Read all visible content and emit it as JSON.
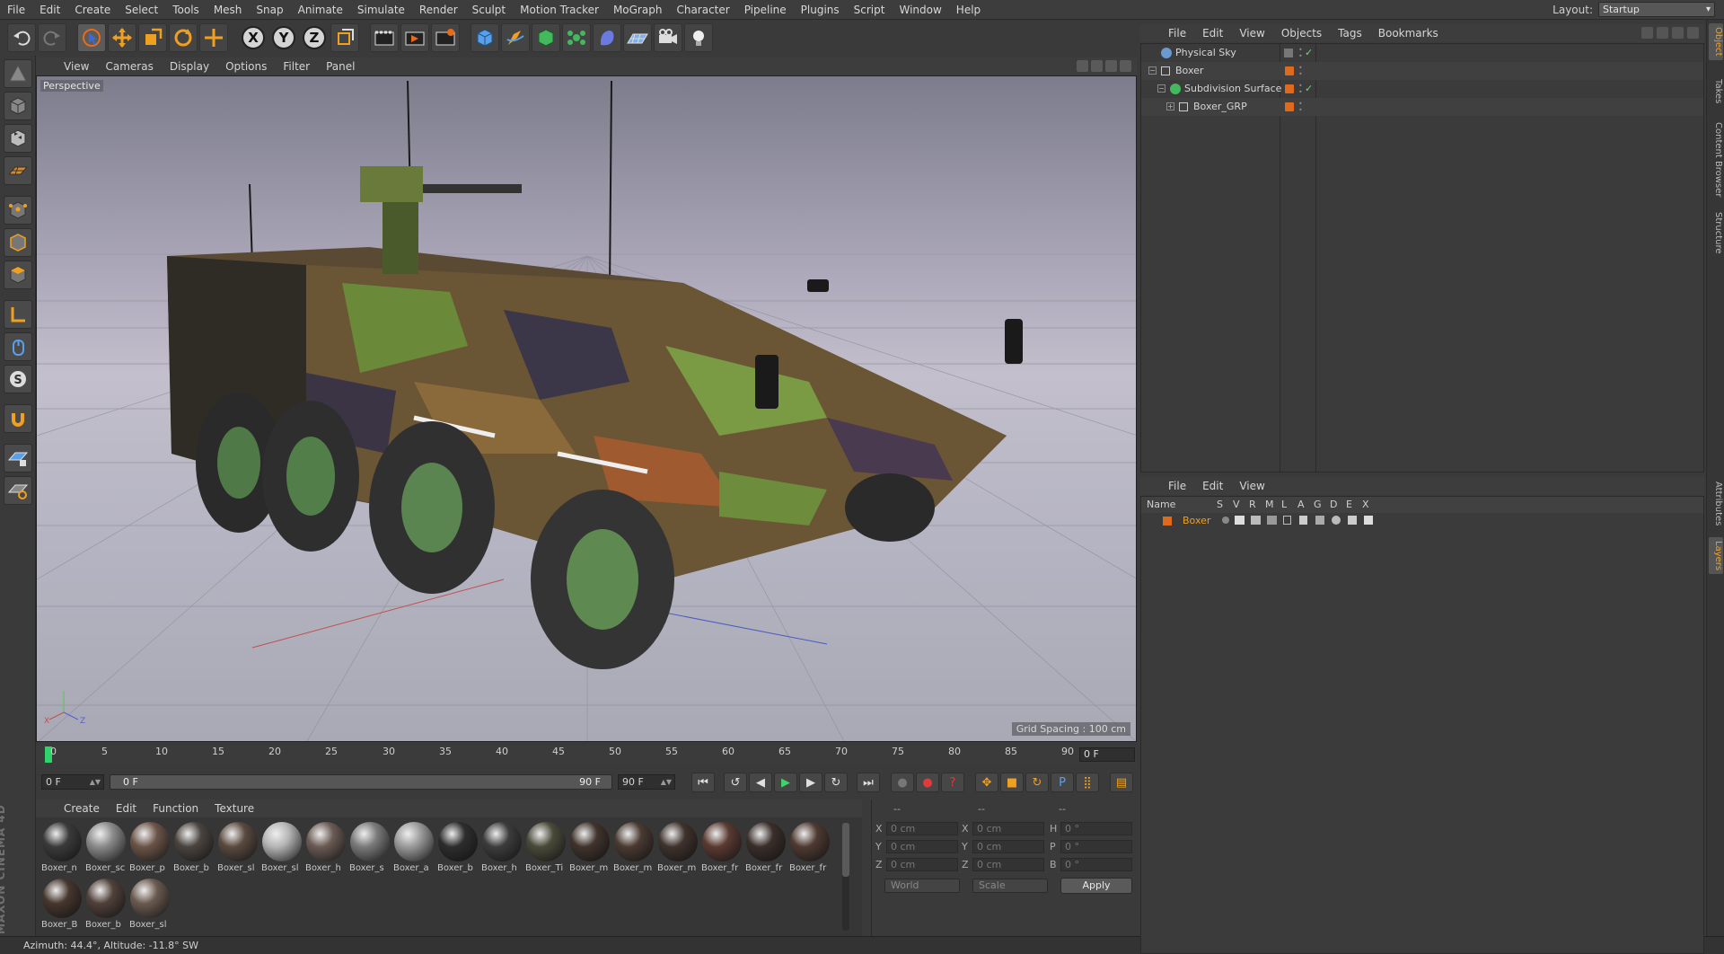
{
  "menubar": {
    "items": [
      "File",
      "Edit",
      "Create",
      "Select",
      "Tools",
      "Mesh",
      "Snap",
      "Animate",
      "Simulate",
      "Render",
      "Sculpt",
      "Motion Tracker",
      "MoGraph",
      "Character",
      "Pipeline",
      "Plugins",
      "Script",
      "Window",
      "Help"
    ],
    "layout_label": "Layout:",
    "layout_value": "Startup"
  },
  "toolbar": {
    "icons": [
      "undo-icon",
      "redo-icon",
      "live-selection-icon",
      "move-icon",
      "scale-icon",
      "rotate-icon",
      "recent-tool-icon",
      "x-axis-icon",
      "y-axis-icon",
      "z-axis-icon",
      "coordinate-system-icon",
      "render-view-icon",
      "render-picture-viewer-icon",
      "edit-render-settings-icon",
      "cube-icon",
      "pen-icon",
      "subdivision-icon",
      "cloner-icon",
      "deformer-icon",
      "floor-icon",
      "camera-icon",
      "light-icon"
    ],
    "axis_labels": [
      "X",
      "Y",
      "Z"
    ]
  },
  "leftbar": {
    "icons": [
      "make-editable-icon",
      "model-mode-icon",
      "texture-mode-icon",
      "workplane-icon",
      "points-mode-icon",
      "edges-mode-icon",
      "polygons-mode-icon",
      "axis-mode-icon",
      "tweak-mode-icon",
      "solo-icon",
      "snap-icon",
      "workplane-lock-icon",
      "locked-workplane-icon"
    ],
    "logo_text": "MAXON CINEMA 4D"
  },
  "viewport": {
    "menu": [
      "View",
      "Cameras",
      "Display",
      "Options",
      "Filter",
      "Panel"
    ],
    "label": "Perspective",
    "grid_spacing": "Grid Spacing : 100 cm"
  },
  "timeline": {
    "ticks": [
      "0",
      "5",
      "10",
      "15",
      "20",
      "25",
      "30",
      "35",
      "40",
      "45",
      "50",
      "55",
      "60",
      "65",
      "70",
      "75",
      "80",
      "85",
      "90"
    ],
    "current_frame": "0 F",
    "start_field": "0 F",
    "range_start": "0 F",
    "range_end": "90 F",
    "end_field": "90 F"
  },
  "materials": {
    "menu": [
      "Create",
      "Edit",
      "Function",
      "Texture"
    ],
    "items": [
      {
        "name": "Boxer_n",
        "color": "#3a3a3a"
      },
      {
        "name": "Boxer_sc",
        "color": "#8a8a8a"
      },
      {
        "name": "Boxer_p",
        "color": "#6b5448"
      },
      {
        "name": "Boxer_b",
        "color": "#4a4440"
      },
      {
        "name": "Boxer_sl",
        "color": "#5a4a40"
      },
      {
        "name": "Boxer_sl",
        "color": "#b5b5b5"
      },
      {
        "name": "Boxer_h",
        "color": "#6a5a54"
      },
      {
        "name": "Boxer_s",
        "color": "#7a7a7a"
      },
      {
        "name": "Boxer_a",
        "color": "#9a9a9a"
      },
      {
        "name": "Boxer_b",
        "color": "#2d2d2d"
      },
      {
        "name": "Boxer_h",
        "color": "#3c3c3c"
      },
      {
        "name": "Boxer_Ti",
        "color": "#4a4a3a"
      },
      {
        "name": "Boxer_m",
        "color": "#40332c"
      },
      {
        "name": "Boxer_m",
        "color": "#4a3a32"
      },
      {
        "name": "Boxer_m",
        "color": "#3e322c"
      },
      {
        "name": "Boxer_fr",
        "color": "#5a3a32"
      },
      {
        "name": "Boxer_fr",
        "color": "#3a2e2a"
      },
      {
        "name": "Boxer_fr",
        "color": "#4e3a32"
      },
      {
        "name": "Boxer_B",
        "color": "#46362e"
      },
      {
        "name": "Boxer_b",
        "color": "#50403a"
      },
      {
        "name": "Boxer_sl",
        "color": "#6a5a50"
      }
    ]
  },
  "coords": {
    "headers": [
      "--",
      "--",
      "--"
    ],
    "rows": [
      {
        "a": "X",
        "av": "0 cm",
        "b": "X",
        "bv": "0 cm",
        "c": "H",
        "cv": "0 °"
      },
      {
        "a": "Y",
        "av": "0 cm",
        "b": "Y",
        "bv": "0 cm",
        "c": "P",
        "cv": "0 °"
      },
      {
        "a": "Z",
        "av": "0 cm",
        "b": "Z",
        "bv": "0 cm",
        "c": "B",
        "cv": "0 °"
      }
    ],
    "space": "World",
    "mode": "Scale",
    "apply": "Apply"
  },
  "status": {
    "text": "Azimuth: 44.4°, Altitude: -11.8°  SW"
  },
  "object_manager": {
    "menu": [
      "File",
      "Edit",
      "View",
      "Objects",
      "Tags",
      "Bookmarks"
    ],
    "objects": [
      {
        "name": "Physical Sky",
        "icon": "sky-icon",
        "depth": 0
      },
      {
        "name": "Boxer",
        "icon": "null-icon",
        "depth": 0
      },
      {
        "name": "Subdivision Surface",
        "icon": "subdivision-icon",
        "depth": 1
      },
      {
        "name": "Boxer_GRP",
        "icon": "null-icon",
        "depth": 2
      }
    ]
  },
  "layer_manager": {
    "menu": [
      "File",
      "Edit",
      "View"
    ],
    "columns": [
      "Name",
      "S",
      "V",
      "R",
      "M",
      "L",
      "A",
      "G",
      "D",
      "E",
      "X"
    ],
    "layers": [
      {
        "name": "Boxer"
      }
    ]
  },
  "right_tabs": [
    "Object",
    "Takes",
    "Content Browser",
    "Structure",
    "Attributes",
    "Layers"
  ],
  "colors": {
    "accent": "#f0a020",
    "tag_orange": "#e06a1c",
    "playhead": "#2fd36a"
  }
}
